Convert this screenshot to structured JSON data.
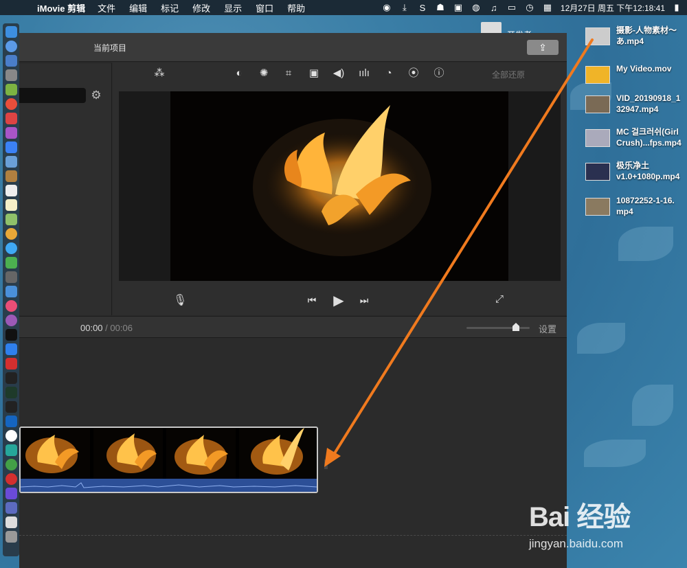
{
  "menubar": {
    "app_name": "iMovie 剪辑",
    "items": [
      "文件",
      "编辑",
      "标记",
      "修改",
      "显示",
      "窗口",
      "帮助"
    ],
    "clock": "12月27日 周五 下午12:18:41"
  },
  "window": {
    "title": "当前项目",
    "share_icon": "share-icon"
  },
  "viewer": {
    "reset_label": "全部还原",
    "tools": [
      "magic-wand-icon",
      "color-balance-icon",
      "color-palette-icon",
      "crop-icon",
      "stabilization-icon",
      "volume-icon",
      "equalizer-icon",
      "speed-icon",
      "overlay-icon",
      "info-icon"
    ]
  },
  "timeline": {
    "current_time": "00:00",
    "separator": "/",
    "duration": "00:06",
    "settings_label": "设置",
    "zoom_fraction": 0.8
  },
  "desktop": {
    "dev_label": "开发者",
    "files": [
      {
        "name": "摄影-人物素材～\nあ.mp4"
      },
      {
        "name": "My Video.mov"
      },
      {
        "name": "VID_20190918_1\n32947.mp4"
      },
      {
        "name": "MC 걸크러쉬(Girl\nCrush)...fps.mp4"
      },
      {
        "name": "极乐净土\nv1.0+1080p.mp4"
      },
      {
        "name": "10872252-1-16.\nmp4"
      }
    ]
  },
  "watermark": {
    "logo_text": "Bai 经验",
    "url": "jingyan.baidu.com"
  },
  "colors": {
    "arrow": "#f07a1e",
    "audio_track": "#2c4f97",
    "menubar": "#1b2a36"
  }
}
